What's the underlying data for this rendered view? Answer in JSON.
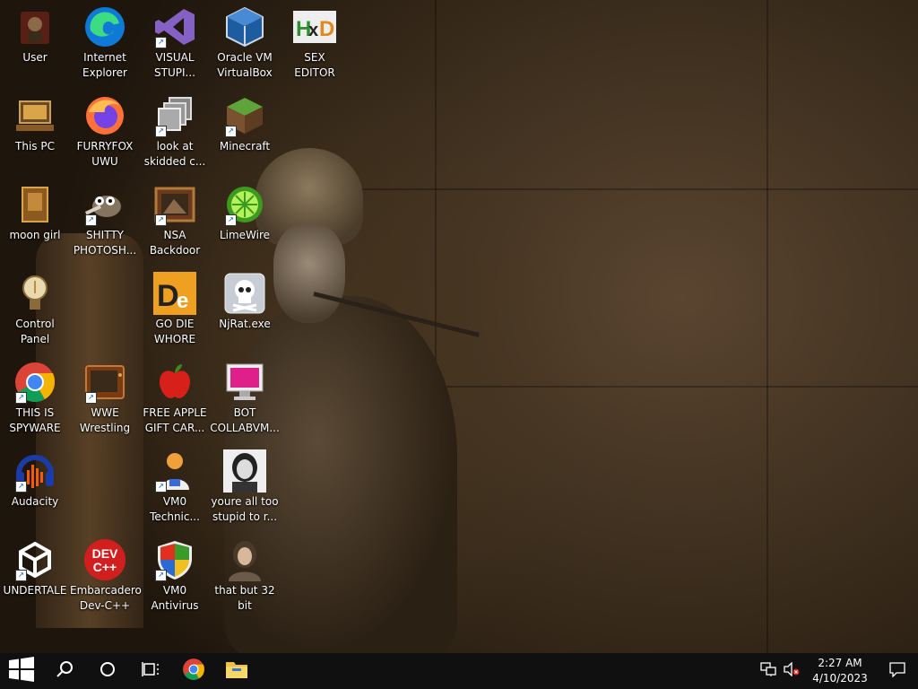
{
  "desktop": {
    "icons": [
      {
        "id": "user",
        "label": "User",
        "icon": "user-folder-icon"
      },
      {
        "id": "internet-explorer",
        "label": "Internet\nExplorer",
        "icon": "edge-icon"
      },
      {
        "id": "visual-studio",
        "label": "VISUAL\nSTUPI...",
        "icon": "visual-studio-icon"
      },
      {
        "id": "virtualbox",
        "label": "Oracle VM\nVirtualBox",
        "icon": "virtualbox-icon"
      },
      {
        "id": "hex-editor",
        "label": "SEX\nEDITOR",
        "icon": "hxd-icon"
      },
      {
        "id": "this-pc",
        "label": "This PC",
        "icon": "computer-icon"
      },
      {
        "id": "firefox",
        "label": "FURRYFOX\nUWU",
        "icon": "firefox-icon"
      },
      {
        "id": "skidded",
        "label": "look at\nskidded c...",
        "icon": "copy-icon"
      },
      {
        "id": "minecraft",
        "label": "Minecraft",
        "icon": "minecraft-icon"
      },
      {
        "id": "moon-girl",
        "label": "moon girl",
        "icon": "book-icon"
      },
      {
        "id": "gimp",
        "label": "SHITTY\nPHOTOSH...",
        "icon": "gimp-icon"
      },
      {
        "id": "nsa-backdoor",
        "label": "NSA\nBackdoor",
        "icon": "framed-picture-icon"
      },
      {
        "id": "limewire",
        "label": "LimeWire",
        "icon": "limewire-icon"
      },
      {
        "id": "control-panel",
        "label": "Control Panel",
        "icon": "lightbulb-icon"
      },
      {
        "id": "go-die",
        "label": "GO DIE\nWHORE",
        "icon": "de-icon"
      },
      {
        "id": "njrat",
        "label": "NjRat.exe",
        "icon": "skull-icon"
      },
      {
        "id": "chrome",
        "label": "THIS IS\nSPYWARE",
        "icon": "chrome-icon"
      },
      {
        "id": "wwe",
        "label": "WWE\nWrestling",
        "icon": "tv-icon"
      },
      {
        "id": "apple-gift",
        "label": "FREE APPLE\nGIFT CAR...",
        "icon": "apple-icon"
      },
      {
        "id": "bot-collab",
        "label": "BOT\nCOLLABVM...",
        "icon": "monitor-icon"
      },
      {
        "id": "audacity",
        "label": "Audacity",
        "icon": "audacity-icon"
      },
      {
        "id": "vm0-tech",
        "label": "VM0\nTechnic...",
        "icon": "technician-icon"
      },
      {
        "id": "stupid",
        "label": "youre all too\nstupid to r...",
        "icon": "portrait-icon"
      },
      {
        "id": "undertale",
        "label": "UNDERTALE",
        "icon": "unity-icon"
      },
      {
        "id": "devcpp",
        "label": "Embarcadero\nDev-C++",
        "icon": "devcpp-icon"
      },
      {
        "id": "vm0-antivirus",
        "label": "VM0\nAntivirus",
        "icon": "shield-icon"
      },
      {
        "id": "that-but-32",
        "label": "that but 32\nbit",
        "icon": "woman-portrait-icon"
      }
    ]
  },
  "taskbar": {
    "start": "windows-start-icon",
    "search": "search-icon",
    "cortana": "cortana-circle-icon",
    "taskview": "task-view-icon",
    "pinned": [
      {
        "name": "chrome",
        "icon": "chrome-icon"
      },
      {
        "name": "file-explorer",
        "icon": "folder-icon"
      }
    ],
    "tray": {
      "network": "network-icon",
      "volume": "volume-muted-icon",
      "time": "2:27 AM",
      "date": "4/10/2023",
      "notifications": "action-center-icon"
    }
  }
}
